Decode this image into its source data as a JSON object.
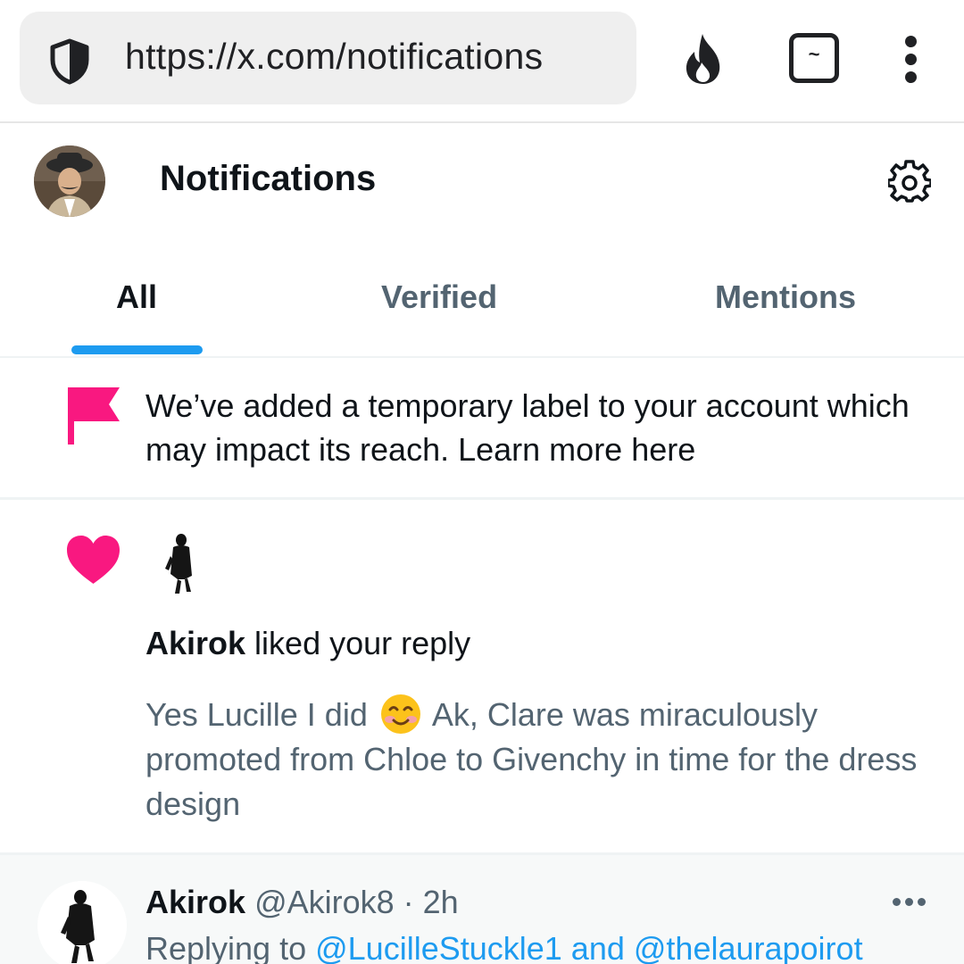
{
  "browser": {
    "url": "https://x.com/notifications",
    "shield_icon": "shield-icon",
    "fire_icon": "fire-icon",
    "tabs_icon_glyph": "~",
    "menu_icon": "kebab-menu-icon"
  },
  "header": {
    "title": "Notifications",
    "settings_icon": "gear-icon"
  },
  "tabs": [
    {
      "label": "All",
      "active": true
    },
    {
      "label": "Verified",
      "active": false
    },
    {
      "label": "Mentions",
      "active": false
    }
  ],
  "notice": {
    "text": "We’ve added a temporary label to your account which may impact its reach. Learn more here",
    "icon": "flag-icon",
    "icon_color": "#f91880"
  },
  "like_notification": {
    "user": "Akirok",
    "action": " liked your reply",
    "icon": "heart-icon",
    "icon_color": "#f91880",
    "preview_before": "Yes Lucille I did ",
    "preview_emoji": "smiling-face-icon",
    "preview_after": " Ak, Clare was miraculously promoted from Chloe to Givenchy in time for the dress design"
  },
  "tweet": {
    "name": "Akirok",
    "handle": "@Akirok8",
    "separator": " · ",
    "time": "2h",
    "replying_prefix": "Replying to ",
    "mention_1": "@LucilleStuckle1",
    "conjunction": " and ",
    "mention_2": "@thelaurapoirot",
    "more_icon": "more-icon"
  },
  "colors": {
    "accent": "#1d9bf0",
    "pink": "#f91880",
    "secondary_text": "#536471"
  }
}
